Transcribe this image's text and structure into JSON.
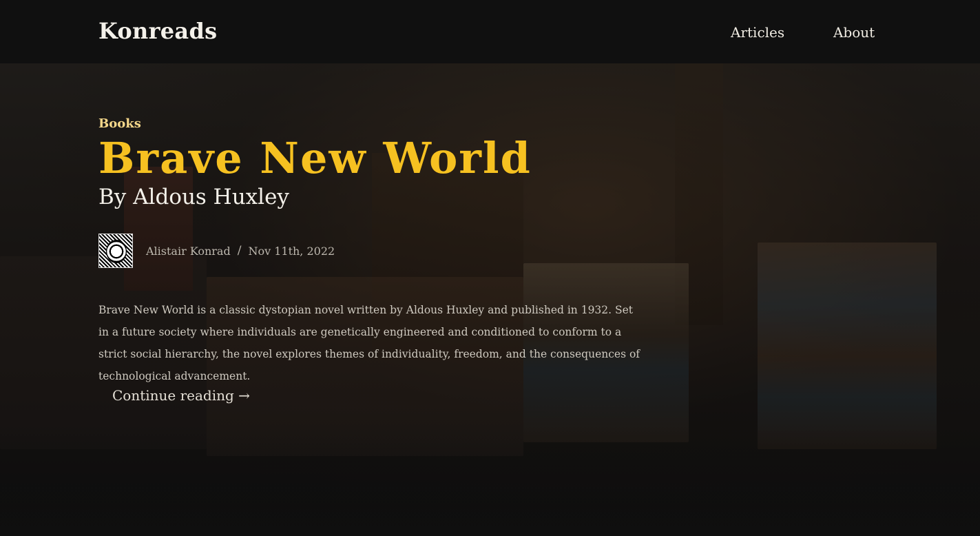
{
  "header": {
    "brand": "Konreads",
    "nav": [
      {
        "label": "Articles"
      },
      {
        "label": "About"
      }
    ]
  },
  "post": {
    "category": "Books",
    "title": "Brave New World",
    "subtitle": "By Aldous Huxley",
    "author": "Alistair Konrad",
    "separator": "/",
    "date": "Nov 11th, 2022",
    "excerpt": "Brave New World is a classic dystopian novel written by Aldous Huxley and published in 1932. Set in a future society where individuals are genetically engineered and conditioned to conform to a strict social hierarchy, the novel explores themes of individuality, freedom, and the consequences of technological advancement.",
    "continue_label": "Continue reading →"
  },
  "colors": {
    "background": "#0f0f0f",
    "accent": "#f6c121",
    "category": "#f5d78a",
    "text": "#f4f1ea",
    "muted": "#bdb8ae"
  }
}
